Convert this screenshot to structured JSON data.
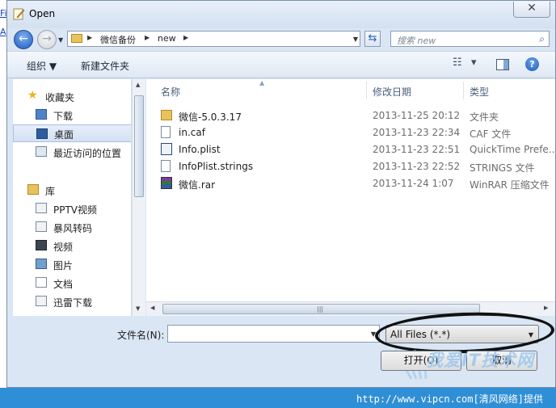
{
  "stray_links": [
    "Fi",
    "A"
  ],
  "window": {
    "title": "Open"
  },
  "address": {
    "crumbs": [
      "微信备份",
      "new"
    ]
  },
  "search": {
    "placeholder": "搜索 new"
  },
  "toolbar": {
    "organize": "组织 ▼",
    "new_folder": "新建文件夹",
    "view_icon": "▾"
  },
  "nav": {
    "favorites": "收藏夹",
    "downloads": "下载",
    "desktop": "桌面",
    "recent": "最近访问的位置",
    "libraries": "库",
    "pptv": "PPTV视频",
    "baofeng": "暴风转码",
    "videos": "视频",
    "pictures": "图片",
    "documents": "文档",
    "thunder": "迅雷下载"
  },
  "columns": {
    "name": "名称",
    "date": "修改日期",
    "type": "类型"
  },
  "files": [
    {
      "name": "微信-5.0.3.17",
      "date": "2013-11-25 20:12",
      "type": "文件夹",
      "icon": "folder-icon"
    },
    {
      "name": "in.caf",
      "date": "2013-11-23 22:34",
      "type": "CAF 文件",
      "icon": "document-icon"
    },
    {
      "name": "Info.plist",
      "date": "2013-11-23 22:51",
      "type": "QuickTime Prefe...",
      "icon": "quicktime-icon"
    },
    {
      "name": "InfoPlist.strings",
      "date": "2013-11-23 22:52",
      "type": "STRINGS 文件",
      "icon": "document-icon"
    },
    {
      "name": "微信.rar",
      "date": "2013-11-24 1:07",
      "type": "WinRAR 压缩文件",
      "icon": "winrar-icon"
    }
  ],
  "bottom": {
    "filename_label": "文件名(N):",
    "filename_value": "",
    "filter_value": "All Files (*.*)",
    "open_label": "打开(O)",
    "cancel_label": "取消"
  },
  "watermark": {
    "logo": "我爱IT技术网",
    "footer": "http://www.vipcn.com[清风网络]提供"
  },
  "colors": {
    "footer_bar": "#2f8fd6",
    "selection": "#d4e1f3"
  }
}
